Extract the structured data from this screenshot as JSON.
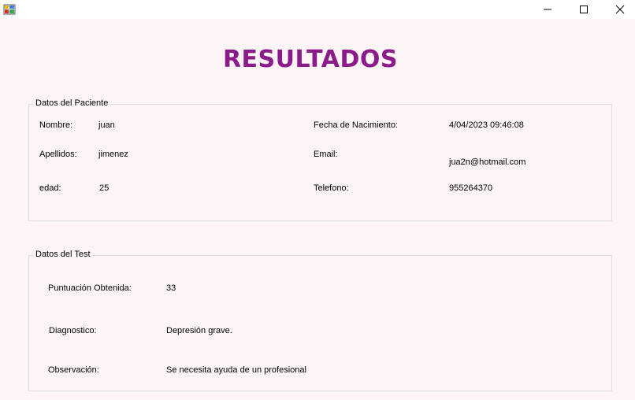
{
  "window": {
    "title": "",
    "minimize_icon": "minimize-icon",
    "maximize_icon": "maximize-icon",
    "close_icon": "close-icon"
  },
  "header": {
    "title": "RESULTADOS"
  },
  "colors": {
    "title": "#8b1a8b",
    "background": "#fdf5f5",
    "border": "#dcdcdc"
  },
  "paciente": {
    "legend": "Datos del Paciente",
    "nombre_label": "Nombre:",
    "nombre_value": "juan",
    "apellidos_label": "Apellidos:",
    "apellidos_value": "jimenez",
    "edad_label": "edad:",
    "edad_value": "25",
    "fecha_label": "Fecha de Nacimiento:",
    "fecha_value": "4/04/2023 09:46:08",
    "email_label": "Email:",
    "email_value": "jua2n@hotmail.com",
    "telefono_label": "Telefono:",
    "telefono_value": "955264370"
  },
  "test": {
    "legend": "Datos del Test",
    "puntuacion_label": "Puntuación Obtenida:",
    "puntuacion_value": "33",
    "diagnostico_label": "Diagnostico:",
    "diagnostico_value": "Depresión grave.",
    "observacion_label": "Observación:",
    "observacion_value": "Se necesita ayuda de un profesional"
  }
}
